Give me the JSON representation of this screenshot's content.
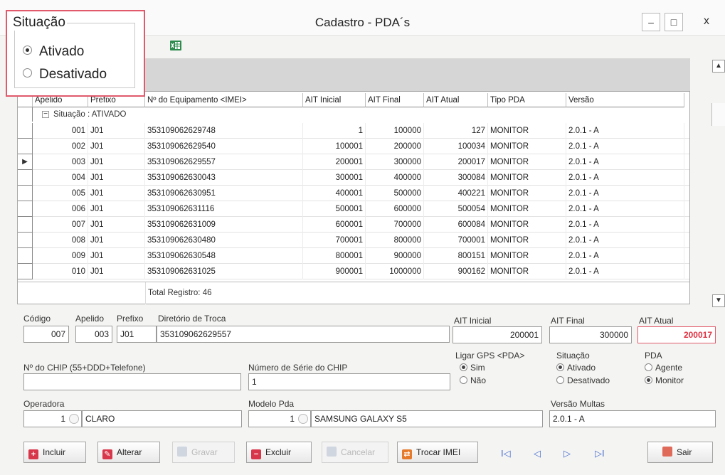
{
  "window": {
    "title": "Cadastro - PDA´s",
    "minimize": "–",
    "maximize": "□",
    "close": "x"
  },
  "situacao_filter": {
    "title": "Situação",
    "options": [
      "Ativado",
      "Desativado"
    ],
    "selected": "Ativado"
  },
  "grid": {
    "columns": [
      "Apelido",
      "Prefixo",
      "Nº do Equipamento <IMEI>",
      "AIT Inicial",
      "AIT Final",
      "AIT Atual",
      "Tipo PDA",
      "Versão"
    ],
    "group_label": "Situação : ATIVADO",
    "group_toggle": "−",
    "current_row_marker": "▶",
    "rows": [
      {
        "apelido": "001",
        "prefixo": "J01",
        "imei": "353109062629748",
        "ait_inicial": "1",
        "ait_final": "100000",
        "ait_atual": "127",
        "tipo": "MONITOR",
        "versao": "2.0.1 - A"
      },
      {
        "apelido": "002",
        "prefixo": "J01",
        "imei": "353109062629540",
        "ait_inicial": "100001",
        "ait_final": "200000",
        "ait_atual": "100034",
        "tipo": "MONITOR",
        "versao": "2.0.1 - A"
      },
      {
        "apelido": "003",
        "prefixo": "J01",
        "imei": "353109062629557",
        "ait_inicial": "200001",
        "ait_final": "300000",
        "ait_atual": "200017",
        "tipo": "MONITOR",
        "versao": "2.0.1 - A"
      },
      {
        "apelido": "004",
        "prefixo": "J01",
        "imei": "353109062630043",
        "ait_inicial": "300001",
        "ait_final": "400000",
        "ait_atual": "300084",
        "tipo": "MONITOR",
        "versao": "2.0.1 - A"
      },
      {
        "apelido": "005",
        "prefixo": "J01",
        "imei": "353109062630951",
        "ait_inicial": "400001",
        "ait_final": "500000",
        "ait_atual": "400221",
        "tipo": "MONITOR",
        "versao": "2.0.1 - A"
      },
      {
        "apelido": "006",
        "prefixo": "J01",
        "imei": "353109062631116",
        "ait_inicial": "500001",
        "ait_final": "600000",
        "ait_atual": "500054",
        "tipo": "MONITOR",
        "versao": "2.0.1 - A"
      },
      {
        "apelido": "007",
        "prefixo": "J01",
        "imei": "353109062631009",
        "ait_inicial": "600001",
        "ait_final": "700000",
        "ait_atual": "600084",
        "tipo": "MONITOR",
        "versao": "2.0.1 - A"
      },
      {
        "apelido": "008",
        "prefixo": "J01",
        "imei": "353109062630480",
        "ait_inicial": "700001",
        "ait_final": "800000",
        "ait_atual": "700001",
        "tipo": "MONITOR",
        "versao": "2.0.1 - A"
      },
      {
        "apelido": "009",
        "prefixo": "J01",
        "imei": "353109062630548",
        "ait_inicial": "800001",
        "ait_final": "900000",
        "ait_atual": "800151",
        "tipo": "MONITOR",
        "versao": "2.0.1 - A"
      },
      {
        "apelido": "010",
        "prefixo": "J01",
        "imei": "353109062631025",
        "ait_inicial": "900001",
        "ait_final": "1000000",
        "ait_atual": "900162",
        "tipo": "MONITOR",
        "versao": "2.0.1 - A"
      }
    ],
    "total_label": "Total Registro: 46",
    "scroll_up": "▲",
    "scroll_down": "▼"
  },
  "form": {
    "codigo": {
      "label": "Código",
      "value": "007"
    },
    "apelido": {
      "label": "Apelido",
      "value": "003"
    },
    "prefixo": {
      "label": "Prefixo",
      "value": "J01"
    },
    "diretorio": {
      "label": "Diretório de Troca",
      "value": "353109062629557"
    },
    "ait_inicial": {
      "label": "AIT Inicial",
      "value": "200001"
    },
    "ait_final": {
      "label": "AIT Final",
      "value": "300000"
    },
    "ait_atual": {
      "label": "AIT Atual",
      "value": "200017"
    },
    "chip": {
      "label": "Nº do CHIP (55+DDD+Telefone)",
      "value": ""
    },
    "serie_chip": {
      "label": "Número de Série do CHIP",
      "value": "1"
    },
    "gps": {
      "label": "Ligar GPS <PDA>",
      "options": [
        "Sim",
        "Não"
      ],
      "selected": "Sim"
    },
    "situacao": {
      "label": "Situação",
      "options": [
        "Ativado",
        "Desativado"
      ],
      "selected": "Ativado"
    },
    "pda": {
      "label": "PDA",
      "options": [
        "Agente",
        "Monitor"
      ],
      "selected": "Monitor"
    },
    "operadora": {
      "label": "Operadora",
      "code": "1",
      "name": "CLARO"
    },
    "modelo": {
      "label": "Modelo Pda",
      "code": "1",
      "name": "SAMSUNG GALAXY S5"
    },
    "versao_multas": {
      "label": "Versão Multas",
      "value": "2.0.1 - A"
    }
  },
  "buttons": {
    "incluir": "Incluir",
    "alterar": "Alterar",
    "gravar": "Gravar",
    "excluir": "Excluir",
    "cancelar": "Cancelar",
    "trocar_imei": "Trocar IMEI",
    "sair": "Sair",
    "nav_first": "I◁",
    "nav_prev": "◁",
    "nav_next": "▷",
    "nav_last": "▷I"
  },
  "colors": {
    "highlight_border": "#e05a6b",
    "ait_atual_text": "#e03040",
    "ait_atual_border": "#e05a6b",
    "excel_icon": "#2e8b4e"
  }
}
